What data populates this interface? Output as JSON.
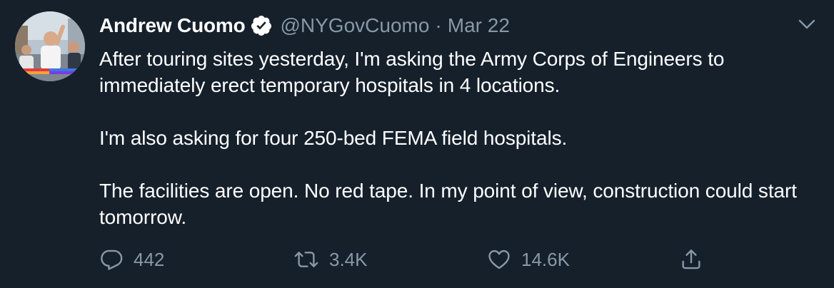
{
  "tweet": {
    "author_name": "Andrew Cuomo",
    "handle": "@NYGovCuomo",
    "separator": "·",
    "date": "Mar 22",
    "paragraphs": [
      "After touring sites yesterday, I'm asking the Army Corps of Engineers to immediately erect temporary hospitals in 4 locations.",
      "I'm also asking for four 250-bed FEMA field hospitals.",
      "The facilities are open. No red tape. In my point of view, construction could start tomorrow."
    ],
    "replies": "442",
    "retweets": "3.4K",
    "likes": "14.6K"
  },
  "icons": {
    "verified": "verified-badge-icon",
    "more": "chevron-down-icon",
    "reply": "reply-icon",
    "retweet": "retweet-icon",
    "like": "heart-icon",
    "share": "share-icon"
  },
  "colors": {
    "background": "#15202b",
    "primary_text": "#ffffff",
    "secondary_text": "#8899a6"
  }
}
